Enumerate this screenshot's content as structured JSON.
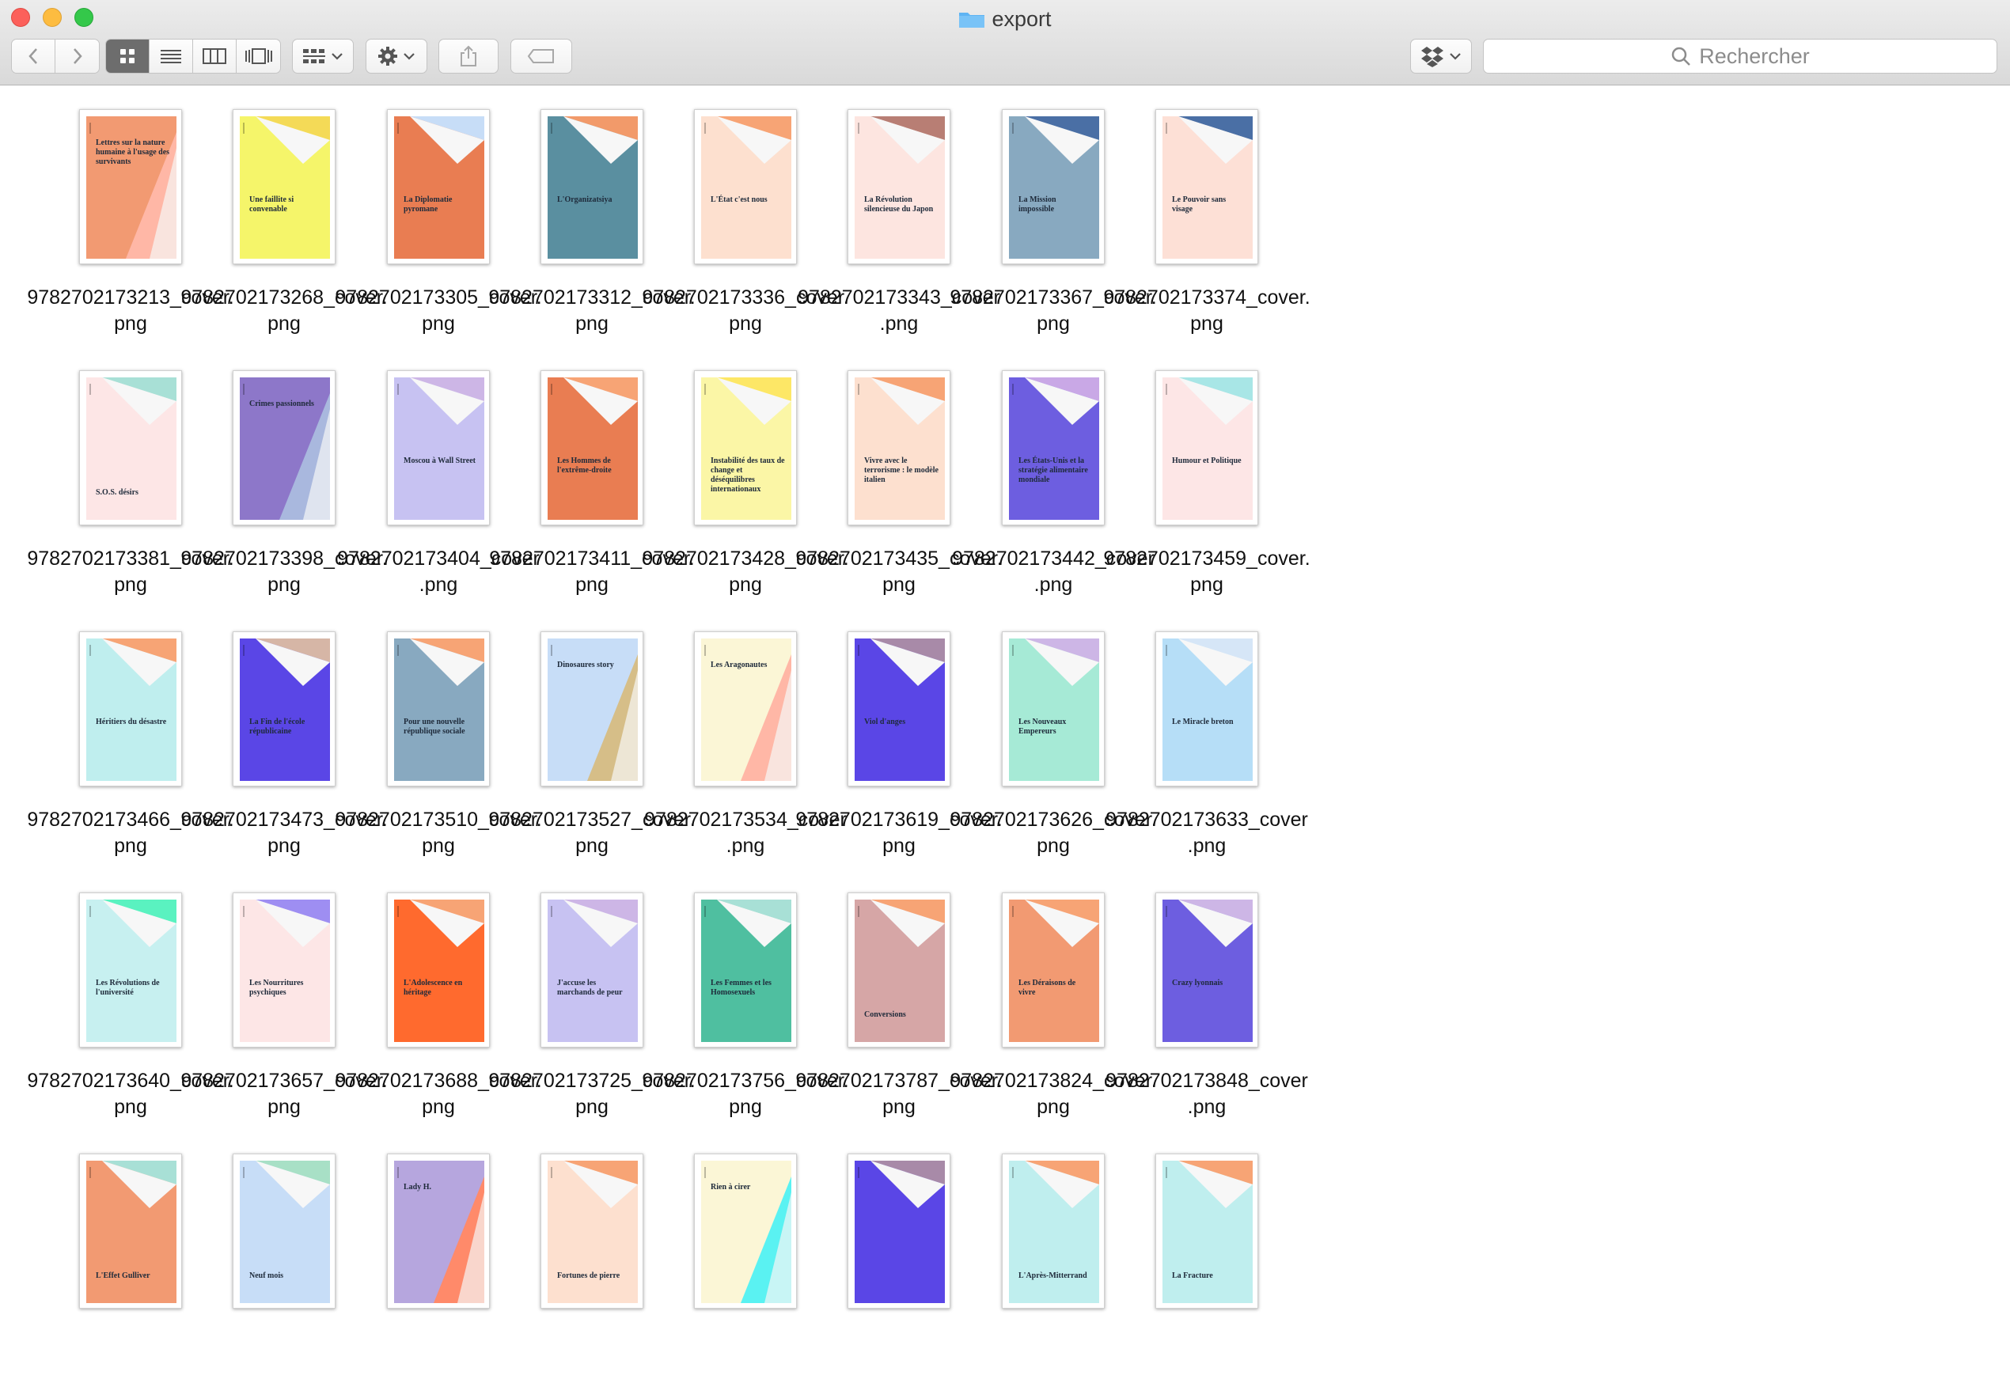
{
  "window": {
    "title": "export",
    "search_placeholder": "Rechercher"
  },
  "colors": {
    "accent_selected": "#6d6d6d",
    "folder": "#5fb4f3"
  },
  "files": [
    {
      "name": "9782702173213_cover.\npng",
      "title": "Lettres sur la nature humaine à l'usage des survivants",
      "color": "#f29a72",
      "accent": "#ffb7a6",
      "pos": "top",
      "tri": "#f7f7f7"
    },
    {
      "name": "9782702173268_cover.\npng",
      "title": "Une faillite si convenable",
      "color": "#f5f56a",
      "accent": "#f4da57",
      "pos": "mid",
      "tri": "#f7f7f7"
    },
    {
      "name": "9782702173305_cover.\npng",
      "title": "La Diplomatie pyromane",
      "color": "#e97d52",
      "accent": "#c7ddf7",
      "pos": "mid",
      "tri": "#f7f7f7"
    },
    {
      "name": "9782702173312_cover.\npng",
      "title": "L'Organizatsiya",
      "color": "#5a8fa0",
      "accent": "#f29a6a",
      "pos": "mid",
      "tri": "#f7f7f7"
    },
    {
      "name": "9782702173336_cover.\npng",
      "title": "L'État c'est nous",
      "color": "#fde0cf",
      "accent": "#f7a475",
      "pos": "mid",
      "tri": "#f7f7f7"
    },
    {
      "name": "9782702173343_cover\n.png",
      "title": "La Révolution silencieuse du Japon",
      "color": "#fde5e0",
      "accent": "#b87e74",
      "pos": "mid",
      "tri": "#f7f7f7"
    },
    {
      "name": "9782702173367_cover.\npng",
      "title": "La Mission impossible",
      "color": "#88a9c0",
      "accent": "#4a6fa5",
      "pos": "mid",
      "tri": "#f7f7f7"
    },
    {
      "name": "9782702173374_cover.\npng",
      "title": "Le Pouvoir sans visage",
      "color": "#fde0d6",
      "accent": "#4a6fa5",
      "pos": "mid",
      "tri": "#f7f7f7"
    },
    {
      "name": "9782702173381_cover.\npng",
      "title": "S.O.S. désirs",
      "color": "#fde6e6",
      "accent": "#a8e0d6",
      "pos": "bottom",
      "tri": "#f7f7f7"
    },
    {
      "name": "9782702173398_cover.\npng",
      "title": "Crimes passionnels",
      "color": "#8d77c9",
      "accent": "#a9b8de",
      "pos": "top",
      "tri": "#f7f7f7"
    },
    {
      "name": "9782702173404_cover\n.png",
      "title": "Moscou à Wall Street",
      "color": "#c7c2f2",
      "accent": "#cdb6e6",
      "pos": "mid",
      "tri": "#f7f7f7"
    },
    {
      "name": "9782702173411_cover.\npng",
      "title": "Les Hommes de l'extrême-droite",
      "color": "#e97d52",
      "accent": "#f7a475",
      "pos": "mid",
      "tri": "#f7f7f7"
    },
    {
      "name": "9782702173428_cover.\npng",
      "title": "Instabilité des taux de change et déséquilibres internationaux",
      "color": "#fbf6a6",
      "accent": "#fde766",
      "pos": "mid",
      "tri": "#f7f7f7"
    },
    {
      "name": "9782702173435_cover.\npng",
      "title": "Vivre avec le terrorisme : le modèle italien",
      "color": "#fde0cf",
      "accent": "#f7a475",
      "pos": "mid",
      "tri": "#f7f7f7"
    },
    {
      "name": "9782702173442_cover\n.png",
      "title": "Les États-Unis et la stratégie alimentaire mondiale",
      "color": "#6d5ee0",
      "accent": "#c9a8e6",
      "pos": "mid",
      "tri": "#f7f7f7"
    },
    {
      "name": "9782702173459_cover.\npng",
      "title": "Humour et Politique",
      "color": "#fde6e6",
      "accent": "#a8e6e6",
      "pos": "mid",
      "tri": "#f7f7f7"
    },
    {
      "name": "9782702173466_cover.\npng",
      "title": "Héritiers du désastre",
      "color": "#bfeeee",
      "accent": "#f7a475",
      "pos": "mid",
      "tri": "#f7f7f7"
    },
    {
      "name": "9782702173473_cover.\npng",
      "title": "La Fin de l'école républicaine",
      "color": "#5a46e6",
      "accent": "#d6b6a6",
      "pos": "mid",
      "tri": "#f7f7f7"
    },
    {
      "name": "9782702173510_cover.\npng",
      "title": "Pour une nouvelle république sociale",
      "color": "#88a9c0",
      "accent": "#f7a475",
      "pos": "mid",
      "tri": "#f7f7f7"
    },
    {
      "name": "9782702173527_cover.\npng",
      "title": "Dinosaures story",
      "color": "#c7ddf7",
      "accent": "#d6be88",
      "pos": "top",
      "tri": "#f7f7f7"
    },
    {
      "name": "9782702173534_cover\n.png",
      "title": "Les Aragonautes",
      "color": "#fbf6d6",
      "accent": "#ffb7a6",
      "pos": "top",
      "tri": "#f7f7f7"
    },
    {
      "name": "9782702173619_cover.\npng",
      "title": "Viol d'anges",
      "color": "#5a46e6",
      "accent": "#a88aa8",
      "pos": "mid",
      "tri": "#f7f7f7"
    },
    {
      "name": "9782702173626_cover.\npng",
      "title": "Les Nouveaux Empereurs",
      "color": "#a6ead6",
      "accent": "#cdb6e6",
      "pos": "mid",
      "tri": "#f7f7f7"
    },
    {
      "name": "9782702173633_cover\n.png",
      "title": "Le Miracle breton",
      "color": "#b6def7",
      "accent": "#d6e6f7",
      "pos": "mid",
      "tri": "#f7f7f7"
    },
    {
      "name": "9782702173640_cover.\npng",
      "title": "Les Révolutions de l'université",
      "color": "#c7f0f0",
      "accent": "#5af2c0",
      "pos": "mid",
      "tri": "#f7f7f7"
    },
    {
      "name": "9782702173657_cover.\npng",
      "title": "Les Nourritures psychiques",
      "color": "#fde6e6",
      "accent": "#9e8ef2",
      "pos": "mid",
      "tri": "#f7f7f7"
    },
    {
      "name": "9782702173688_cover.\npng",
      "title": "L'Adolescence en héritage",
      "color": "#ff6a2e",
      "accent": "#f7a475",
      "pos": "mid",
      "tri": "#f7f7f7"
    },
    {
      "name": "9782702173725_cover.\npng",
      "title": "J'accuse les marchands de peur",
      "color": "#c7c2f2",
      "accent": "#cdb6e6",
      "pos": "mid",
      "tri": "#f7f7f7"
    },
    {
      "name": "9782702173756_cover.\npng",
      "title": "Les Femmes et les Homosexuels",
      "color": "#4fbfa0",
      "accent": "#a8e0d6",
      "pos": "mid",
      "tri": "#f7f7f7"
    },
    {
      "name": "9782702173787_cover.\npng",
      "title": "Conversions",
      "color": "#d6a6a6",
      "accent": "#f7a475",
      "pos": "bottom",
      "tri": "#f7f7f7"
    },
    {
      "name": "9782702173824_cover.\npng",
      "title": "Les Déraisons de vivre",
      "color": "#f29a72",
      "accent": "#f7a475",
      "pos": "mid",
      "tri": "#f7f7f7"
    },
    {
      "name": "9782702173848_cover\n.png",
      "title": "Crazy lyonnais",
      "color": "#6d5ee0",
      "accent": "#cdb6e6",
      "pos": "mid",
      "tri": "#f7f7f7"
    },
    {
      "name": "",
      "title": "L'Effet Gulliver",
      "color": "#f29a72",
      "accent": "#a8e0d6",
      "pos": "bottom",
      "tri": "#f7f7f7"
    },
    {
      "name": "",
      "title": "Neuf mois",
      "color": "#c7ddf7",
      "accent": "#a8e0c6",
      "pos": "bottom",
      "tri": "#f7f7f7"
    },
    {
      "name": "",
      "title": "Lady H.",
      "color": "#b6a6de",
      "accent": "#ff8a6a",
      "pos": "top",
      "tri": "#f7f7f7"
    },
    {
      "name": "",
      "title": "Fortunes de pierre",
      "color": "#fde0cf",
      "accent": "#f7a475",
      "pos": "bottom",
      "tri": "#f7f7f7"
    },
    {
      "name": "",
      "title": "Rien à cirer",
      "color": "#fbf6d6",
      "accent": "#5af2f2",
      "pos": "top",
      "tri": "#f7f7f7"
    },
    {
      "name": "",
      "title": "",
      "color": "#5a46e6",
      "accent": "#a88aa8",
      "pos": "bottom",
      "tri": "#f7f7f7"
    },
    {
      "name": "",
      "title": "L'Après-Mitterrand",
      "color": "#bfeeee",
      "accent": "#f7a475",
      "pos": "bottom",
      "tri": "#f7f7f7"
    },
    {
      "name": "",
      "title": "La Fracture",
      "color": "#bfeeee",
      "accent": "#f7a475",
      "pos": "bottom",
      "tri": "#f7f7f7"
    }
  ]
}
